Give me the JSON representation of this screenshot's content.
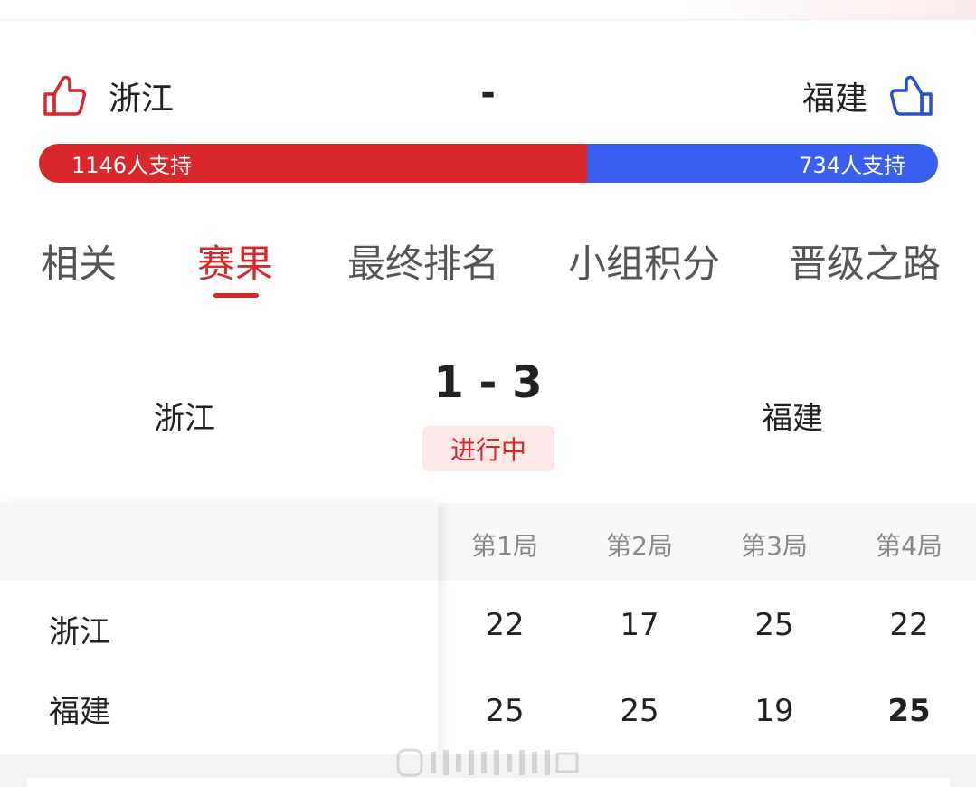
{
  "vote": {
    "home_team": "浙江",
    "away_team": "福建",
    "score_placeholder": "-",
    "home_support": "1146人支持",
    "away_support": "734人支持",
    "home_support_count": 1146,
    "away_support_count": 734,
    "home_color": "#d8282b",
    "away_color": "#3a5ef0",
    "home_icon": "thumbs-up-icon",
    "away_icon": "thumbs-up-icon"
  },
  "tabs": [
    {
      "label": "相关",
      "active": false
    },
    {
      "label": "赛果",
      "active": true
    },
    {
      "label": "最终排名",
      "active": false
    },
    {
      "label": "小组积分",
      "active": false
    },
    {
      "label": "晋级之路",
      "active": false
    }
  ],
  "match": {
    "home_team": "浙江",
    "away_team": "福建",
    "score": "1 - 3",
    "status": "进行中"
  },
  "sets_table": {
    "headers": [
      "第1局",
      "第2局",
      "第3局",
      "第4局"
    ],
    "rows": [
      {
        "team": "浙江",
        "scores": [
          "22",
          "17",
          "25",
          "22"
        ]
      },
      {
        "team": "福建",
        "scores": [
          "25",
          "25",
          "19",
          "25"
        ]
      }
    ]
  }
}
